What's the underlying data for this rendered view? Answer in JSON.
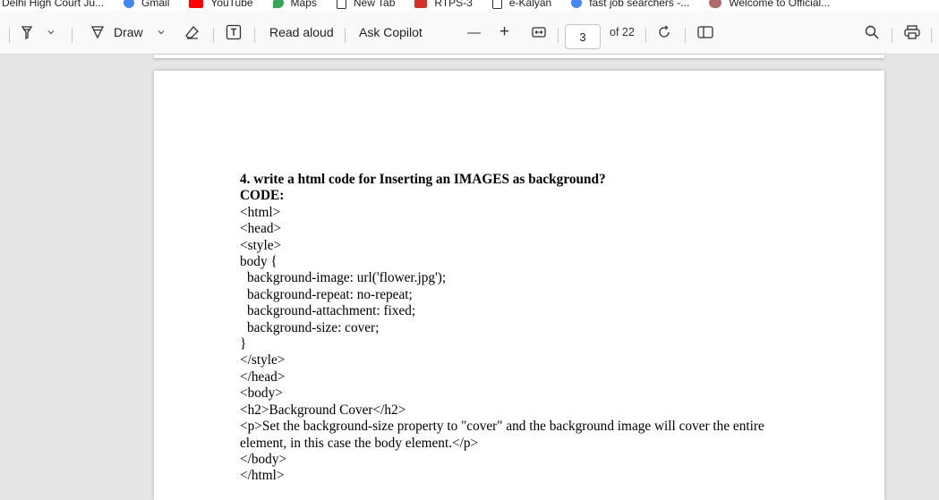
{
  "bookmarks": [
    {
      "label": "Delhi High Court Ju...",
      "icon": "court-icon",
      "color": "#ffffff"
    },
    {
      "label": "Gmail",
      "icon": "google-icon",
      "color": "#4285f4"
    },
    {
      "label": "YouTube",
      "icon": "youtube-icon",
      "color": "#ff0000"
    },
    {
      "label": "Maps",
      "icon": "maps-icon",
      "color": "#34a853"
    },
    {
      "label": "New Tab",
      "icon": "page-icon",
      "color": "#ffffff"
    },
    {
      "label": "RTPS-3",
      "icon": "rtps-icon",
      "color": "#d93025"
    },
    {
      "label": "e-Kalyan",
      "icon": "page-icon",
      "color": "#ffffff"
    },
    {
      "label": "fast job searchers -...",
      "icon": "google-icon",
      "color": "#4285f4"
    },
    {
      "label": "Welcome to Official...",
      "icon": "emblem-icon",
      "color": "#b06a6a"
    }
  ],
  "toolbar": {
    "draw_label": "Draw",
    "read_aloud_label": "Read aloud",
    "ask_copilot_label": "Ask Copilot",
    "zoom_out_symbol": "—",
    "zoom_in_symbol": "+",
    "current_page": "3",
    "page_total": "of 22"
  },
  "document": {
    "question": "4. write a html code for Inserting an IMAGES as background?",
    "code_heading": "CODE:",
    "lines": [
      {
        "text": "<html>",
        "indent": false
      },
      {
        "text": "<head>",
        "indent": false
      },
      {
        "text": "<style>",
        "indent": false
      },
      {
        "text": "body {",
        "indent": false
      },
      {
        "text": "background-image: url('flower.jpg');",
        "indent": true
      },
      {
        "text": "background-repeat: no-repeat;",
        "indent": true
      },
      {
        "text": "background-attachment: fixed;",
        "indent": true
      },
      {
        "text": "background-size: cover;",
        "indent": true
      },
      {
        "text": "}",
        "indent": false
      },
      {
        "text": "</style>",
        "indent": false
      },
      {
        "text": "</head>",
        "indent": false
      },
      {
        "text": "<body>",
        "indent": false
      },
      {
        "text": "<h2>Background Cover</h2>",
        "indent": false
      },
      {
        "text": "<p>Set the background-size property to \"cover\" and the background image will cover the entire",
        "indent": false
      },
      {
        "text": "element, in this case the body element.</p>",
        "indent": false
      },
      {
        "text": "</body>",
        "indent": false
      },
      {
        "text": "</html>",
        "indent": false
      }
    ]
  }
}
